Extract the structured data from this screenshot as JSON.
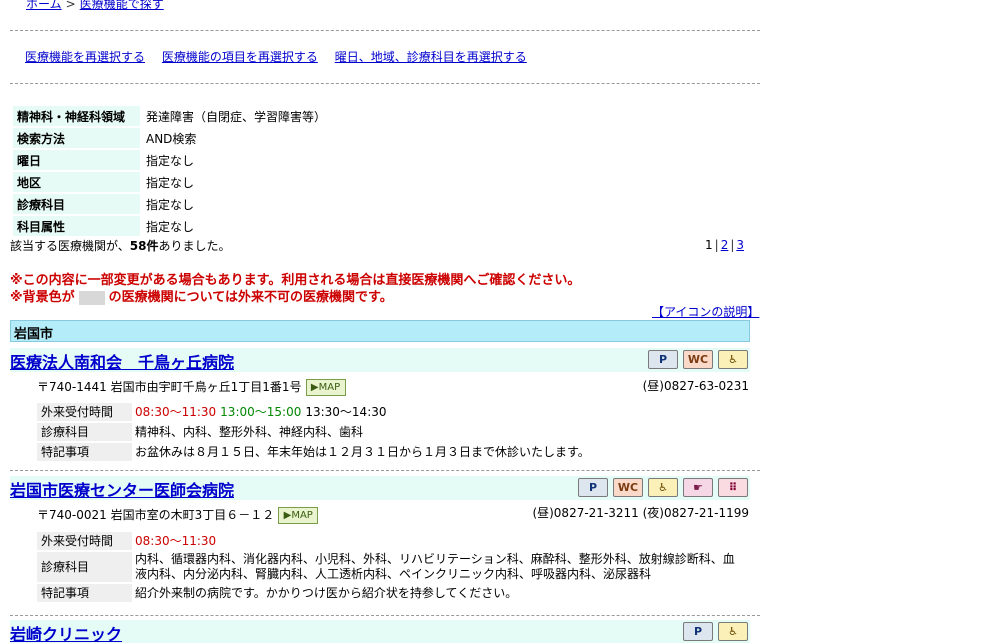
{
  "breadcrumb": {
    "home": "ホーム",
    "sep": ">",
    "current": "医療機能で探す"
  },
  "relinks": [
    "医療機能を再選択する",
    "医療機能の項目を再選択する",
    "曜日、地域、診療科目を再選択する"
  ],
  "conditions": [
    {
      "key": "精神科・神経科領域",
      "value": "発達障害（自閉症、学習障害等）"
    },
    {
      "key": "検索方法",
      "value": "AND検索"
    },
    {
      "key": "曜日",
      "value": "指定なし"
    },
    {
      "key": "地区",
      "value": "指定なし"
    },
    {
      "key": "診療科目",
      "value": "指定なし"
    },
    {
      "key": "科目属性",
      "value": "指定なし"
    }
  ],
  "hits": {
    "prefix": "該当する医療機関が、",
    "count": "58件",
    "suffix": "ありました。"
  },
  "pager": {
    "current": "1",
    "sep": "|",
    "p2": "2",
    "p3": "3"
  },
  "notice": {
    "line1": "※この内容に一部変更がある場合もあります。利用される場合は直接医療機関へご確認ください。",
    "line2_prefix": "※背景色が",
    "line2_suffix": "の医療機関については外来不可の医療機関です。"
  },
  "icon_explanation": "【アイコンの説明】",
  "region": "岩国市",
  "labels": {
    "reception": "外来受付時間",
    "departments": "診療科目",
    "notes": "特記事項",
    "map": "MAP"
  },
  "icon_labels": {
    "parking": "P",
    "wc": "WC",
    "wheelchair": "♿",
    "hand": "☛",
    "dots": "⠿"
  },
  "clinics": [
    {
      "name": "医療法人南和会　千鳥ヶ丘病院",
      "address": "〒740-1441 岩国市由宇町千鳥ヶ丘1丁目1番1号",
      "tel": "(昼)0827-63-0231",
      "hours_am": "08:30～11:30",
      "hours_pm": "13:00～15:00",
      "hours_x": "13:30～14:30",
      "departments": "精神科、内科、整形外科、神経内科、歯科",
      "notes": "お盆休みは８月１５日、年末年始は１２月３１日から１月３日まで休診いたします。"
    },
    {
      "name": "岩国市医療センター医師会病院",
      "address": "〒740-0021 岩国市室の木町3丁目６－１２",
      "tel": "(昼)0827-21-3211 (夜)0827-21-1199",
      "hours_am": "08:30～11:30",
      "departments": "内科、循環器内科、消化器内科、小児科、外科、リハビリテーション科、麻酔科、整形外科、放射線診断科、血液内科、内分泌内科、腎臓内科、人工透析内科、ペインクリニック内科、呼吸器内科、泌尿器科",
      "notes": "紹介外来制の病院です。かかりつけ医から紹介状を持参してください。"
    },
    {
      "name": "岩崎クリニック"
    }
  ]
}
